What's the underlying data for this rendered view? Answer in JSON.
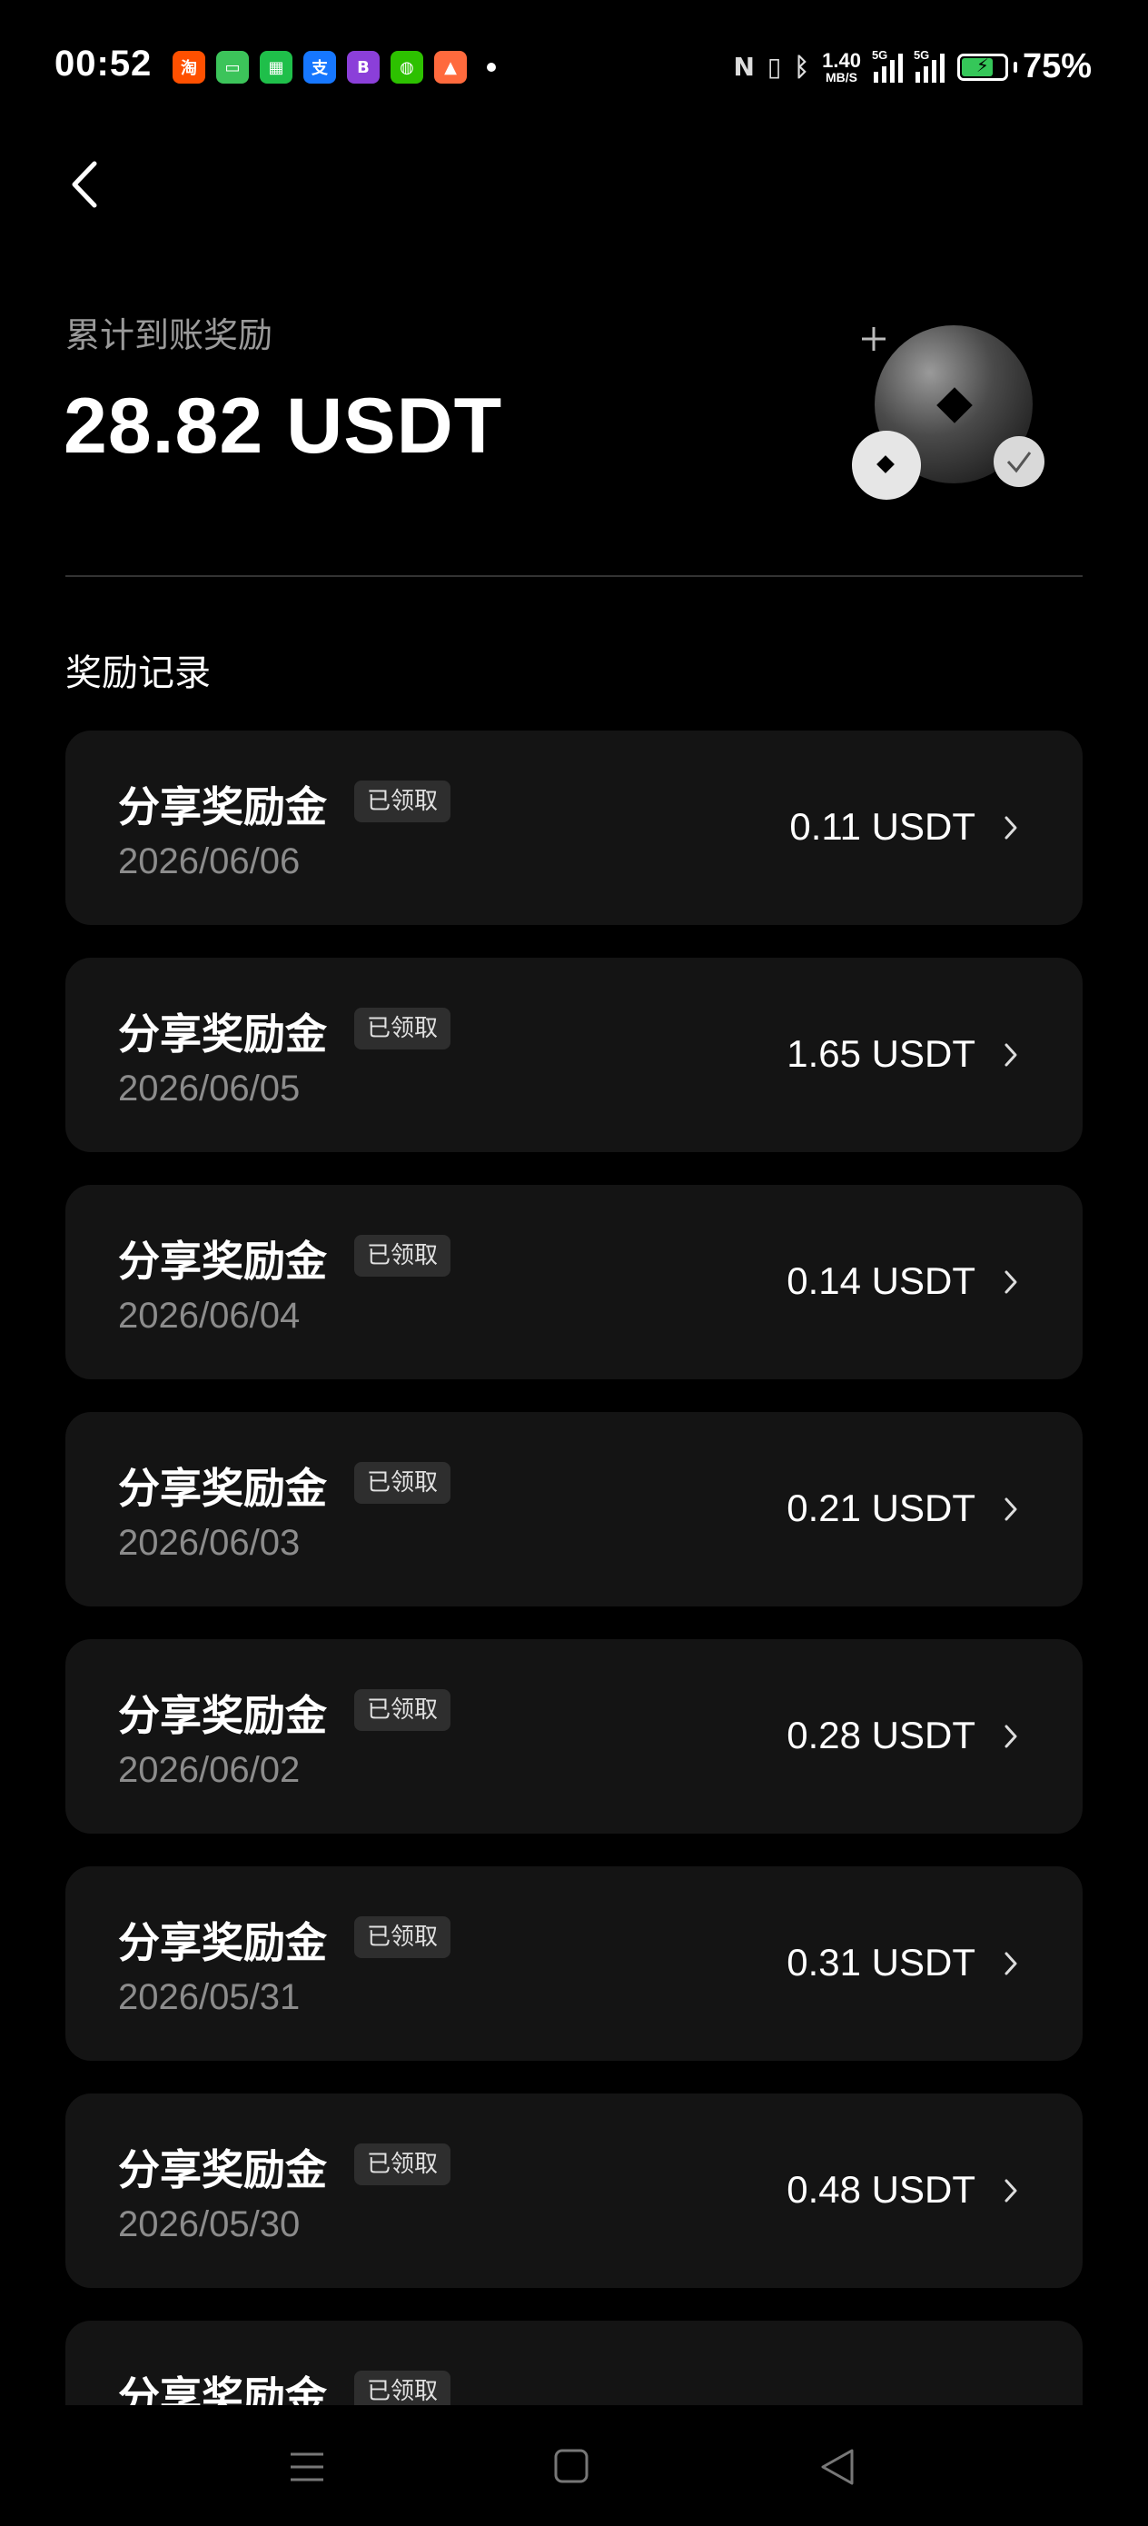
{
  "status_bar": {
    "time": "00:52",
    "net_speed_value": "1.40",
    "net_speed_unit": "MB/S",
    "signal1_label": "5G",
    "signal2_label": "5G",
    "battery_percent": "75%",
    "battery_level": 0.75,
    "apps": [
      {
        "name": "taobao-icon",
        "glyph": "淘",
        "color": "#ff5000"
      },
      {
        "name": "messages-icon",
        "glyph": "▭",
        "color": "#3cc45a"
      },
      {
        "name": "app-grid-icon",
        "glyph": "▦",
        "color": "#1fbf4a"
      },
      {
        "name": "alipay-icon",
        "glyph": "支",
        "color": "#1677ff"
      },
      {
        "name": "bank-icon",
        "glyph": "B",
        "color": "#8b3fd9"
      },
      {
        "name": "wechat-icon",
        "glyph": "◍",
        "color": "#2dc100"
      },
      {
        "name": "gallery-icon",
        "glyph": "▲",
        "color": "#ff6a3d"
      }
    ]
  },
  "header": {
    "total_label": "累计到账奖励",
    "total_amount": "28.82 USDT"
  },
  "records": {
    "title": "奖励记录",
    "items": [
      {
        "title": "分享奖励金",
        "badge": "已领取",
        "date": "2026/06/06",
        "amount": "0.11 USDT"
      },
      {
        "title": "分享奖励金",
        "badge": "已领取",
        "date": "2026/06/05",
        "amount": "1.65 USDT"
      },
      {
        "title": "分享奖励金",
        "badge": "已领取",
        "date": "2026/06/04",
        "amount": "0.14 USDT"
      },
      {
        "title": "分享奖励金",
        "badge": "已领取",
        "date": "2026/06/03",
        "amount": "0.21 USDT"
      },
      {
        "title": "分享奖励金",
        "badge": "已领取",
        "date": "2026/06/02",
        "amount": "0.28 USDT"
      },
      {
        "title": "分享奖励金",
        "badge": "已领取",
        "date": "2026/05/31",
        "amount": "0.31 USDT"
      },
      {
        "title": "分享奖励金",
        "badge": "已领取",
        "date": "2026/05/30",
        "amount": "0.48 USDT"
      },
      {
        "title": "分享奖励金",
        "badge": "已领取",
        "date": "",
        "amount": ""
      }
    ]
  },
  "nav": {
    "items": [
      "menu-icon",
      "home-icon",
      "back-triangle-icon"
    ]
  }
}
